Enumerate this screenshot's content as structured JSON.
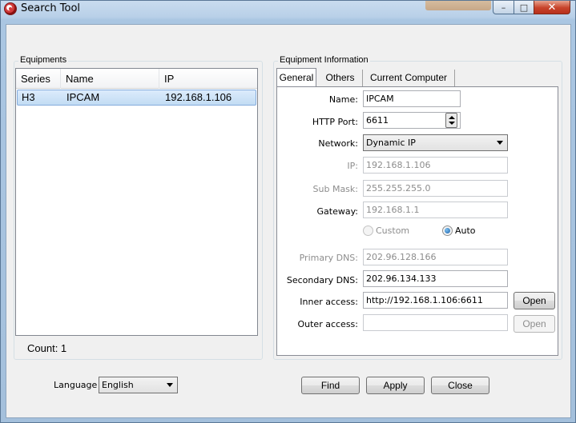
{
  "window": {
    "title": "Search Tool",
    "min_glyph": "–",
    "max_glyph": "□",
    "close_glyph": "✕"
  },
  "equipments": {
    "group_label": "Equipments",
    "columns": [
      "Series",
      "Name",
      "IP"
    ],
    "rows": [
      {
        "series": "H3",
        "name": "IPCAM",
        "ip": "192.168.1.106"
      }
    ],
    "count_label": "Count: 1"
  },
  "info": {
    "group_label": "Equipment Information",
    "tabs": [
      "General",
      "Others",
      "Current Computer"
    ],
    "active_tab": "General",
    "fields": {
      "name": {
        "label": "Name:",
        "value": "IPCAM"
      },
      "http_port": {
        "label": "HTTP Port:",
        "value": "6611"
      },
      "network": {
        "label": "Network:",
        "value": "Dynamic IP"
      },
      "ip": {
        "label": "IP:",
        "value": "192.168.1.106"
      },
      "sub_mask": {
        "label": "Sub Mask:",
        "value": "255.255.255.0"
      },
      "gateway": {
        "label": "Gateway:",
        "value": "192.168.1.1"
      },
      "dns_custom": {
        "label": "Custom"
      },
      "dns_auto": {
        "label": "Auto"
      },
      "primary_dns": {
        "label": "Primary DNS:",
        "value": "202.96.128.166"
      },
      "secondary_dns": {
        "label": "Secondary DNS:",
        "value": "202.96.134.133"
      },
      "inner_access": {
        "label": "Inner access:",
        "value": "http://192.168.1.106:6611",
        "button": "Open"
      },
      "outer_access": {
        "label": "Outer access:",
        "value": "",
        "button": "Open"
      }
    }
  },
  "footer": {
    "language_label": "Language",
    "language_value": "English",
    "find": "Find",
    "apply": "Apply",
    "close": "Close"
  }
}
